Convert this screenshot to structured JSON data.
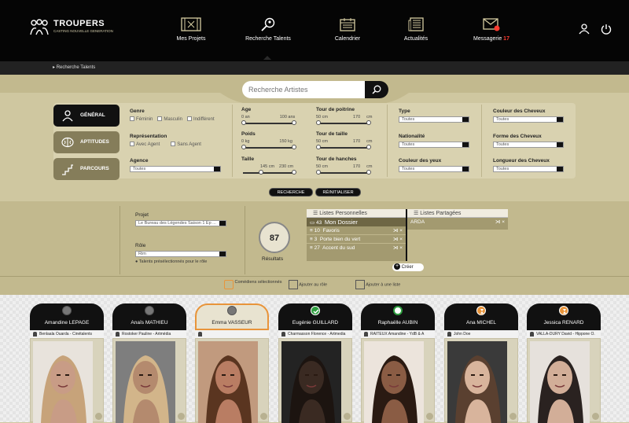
{
  "app": {
    "name": "TROUPERS",
    "tagline": "CASTING NOUVELLE GENERATION"
  },
  "nav": [
    {
      "label": "Mes Projets",
      "icon": "film-icon"
    },
    {
      "label": "Recherche Talents",
      "icon": "search-talent-icon"
    },
    {
      "label": "Calendrier",
      "icon": "calendar-icon"
    },
    {
      "label": "Actualités",
      "icon": "news-icon"
    },
    {
      "label": "Messagerie",
      "count": "17",
      "icon": "mail-icon"
    }
  ],
  "breadcrumb": "Recherche Talents",
  "search": {
    "placeholder": "Recherche Artistes"
  },
  "tabs": [
    {
      "label": "GÉNÉRAL",
      "icon": "person-icon"
    },
    {
      "label": "APTITUDES",
      "icon": "brain-icon"
    },
    {
      "label": "PARCOURS",
      "icon": "stairs-icon"
    }
  ],
  "filters": {
    "genre": {
      "label": "Genre",
      "options": [
        "Féminin",
        "Masculin",
        "Indifférent"
      ]
    },
    "representation": {
      "label": "Représentation",
      "options": [
        "Avec Agent",
        "Sans Agent"
      ]
    },
    "agence": {
      "label": "Agence",
      "value": "Toutes"
    },
    "age": {
      "label": "Age",
      "min": "0 an",
      "max": "100 ans"
    },
    "poids": {
      "label": "Poids",
      "min": "0 kg",
      "max": "150 kg"
    },
    "taille": {
      "label": "Taille",
      "min": "145 cm",
      "max": "230 cm"
    },
    "poitrine": {
      "label": "Tour de poitrine",
      "min": "50 cm",
      "max": "170",
      "unit": "cm"
    },
    "tour_taille": {
      "label": "Tour de taille",
      "min": "50 cm",
      "max": "170",
      "unit": "cm"
    },
    "hanches": {
      "label": "Tour de hanches",
      "min": "50 cm",
      "max": "170",
      "unit": "cm"
    },
    "type": {
      "label": "Type",
      "value": "Toutes"
    },
    "nationalite": {
      "label": "Nationalité",
      "value": "Toutes"
    },
    "couleur_yeux": {
      "label": "Couleur des yeux",
      "value": "Toutes"
    },
    "couleur_cheveux": {
      "label": "Couleur des Cheveux",
      "value": "Toutes"
    },
    "forme_cheveux": {
      "label": "Forme des Cheveux",
      "value": "Toutes"
    },
    "longueur_cheveux": {
      "label": "Longueur des Cheveux",
      "value": "Toutes"
    }
  },
  "buttons": {
    "search": "RECHERCHE",
    "reset": "RÉINITIALISER",
    "create": "Créer"
  },
  "projet": {
    "label": "Projet",
    "value": "Le Bureau des Légendes Saison 1 Ep ..."
  },
  "role": {
    "label": "Rôle",
    "value": "Rim",
    "preselected": "Talents présélectionnés pour le rôle"
  },
  "results": {
    "count": "87",
    "label": "Résultats"
  },
  "lists_personal": {
    "title": "Listes Personnelles",
    "folder": {
      "count": "43",
      "name": "Mon Dossier"
    },
    "items": [
      {
        "count": "10",
        "name": "Favoris"
      },
      {
        "count": "3",
        "name": "Porte bien du vert"
      },
      {
        "count": "27",
        "name": "Accent du sud"
      }
    ]
  },
  "lists_shared": {
    "title": "Listes Partagées",
    "items": [
      {
        "name": "ARDA"
      }
    ]
  },
  "actions": [
    "Comédiens sélectionnés",
    "Ajouter au rôle",
    "Ajouter à une liste"
  ],
  "cards": [
    {
      "name": "Amandine LEPAGE",
      "agent": "Benlaala Ouarda - Cinétalents",
      "status": "none"
    },
    {
      "name": "Anaïs MATHIEU",
      "agent": "Rostoker Pauline - Artmédia",
      "status": "none"
    },
    {
      "name": "Emma VASSEUR",
      "agent": "",
      "status": "selected"
    },
    {
      "name": "Eugénie GUILLARD",
      "agent": "Charmasson Florence - Artmedia",
      "status": "check"
    },
    {
      "name": "Raphaëlle AUBIN",
      "agent": "RAITEUX Amandine - YdB & A",
      "status": "green"
    },
    {
      "name": "Ana MICHEL",
      "agent": "John Doe",
      "status": "hourglass"
    },
    {
      "name": "Jessica RENARD",
      "agent": "VALLA-DURY David - Hippone O.",
      "status": "hourglass"
    }
  ],
  "colors": {
    "accent": "#e8943a",
    "panel": "#cfc7a0",
    "topbar": "#050505",
    "alert": "#ff3b30"
  }
}
